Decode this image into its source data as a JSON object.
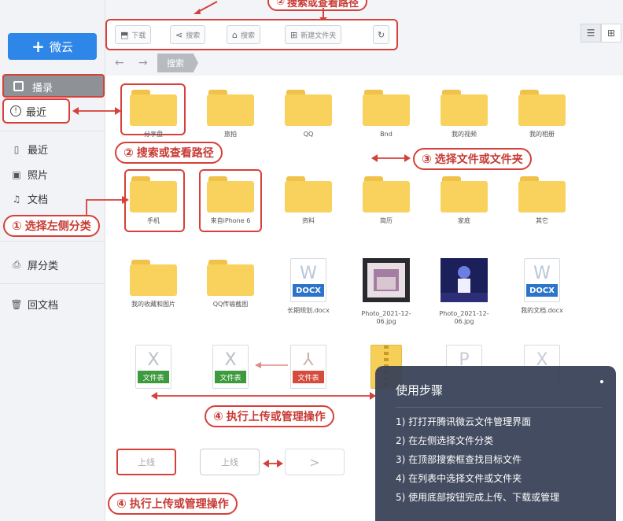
{
  "sidebar": {
    "new_button": {
      "icon": "plus-icon",
      "label": "微云"
    },
    "selected_item": {
      "label": "播录"
    },
    "recent_highlight": {
      "label": "最近"
    },
    "items": [
      {
        "label": "最近",
        "icon": "clock-icon"
      },
      {
        "label": "照片",
        "icon": "image-icon"
      },
      {
        "label": "文档",
        "icon": "music-icon"
      },
      {
        "label": "屏分类",
        "icon": "category-icon"
      },
      {
        "label": "回文档",
        "icon": "trash-icon"
      }
    ]
  },
  "toolbar": {
    "buttons": [
      {
        "label": "下载",
        "icon": "upload-icon"
      },
      {
        "label": "搜索",
        "icon": "share-icon"
      },
      {
        "label": "搜索",
        "icon": "home-icon"
      },
      {
        "label": "新建文件夹",
        "icon": "new-folder-icon"
      },
      {
        "label": "",
        "icon": "refresh-icon"
      }
    ]
  },
  "breadcrumb": {
    "back": "←",
    "forward": "→",
    "current": "搜索"
  },
  "files": {
    "row1": [
      "分享盘",
      "旅拍",
      "QQ",
      "Bnd",
      "我的视频",
      "我的相册"
    ],
    "row2": [
      "手机",
      "来自iPhone 6",
      "资料",
      "简历",
      "家庭",
      "其它"
    ],
    "row3": [
      {
        "type": "folder",
        "label": "我的收藏和图片"
      },
      {
        "type": "folder",
        "label": "QQ传输截图"
      },
      {
        "type": "docx",
        "badge": "DOCX",
        "letter": "W",
        "label": "长期规划.docx"
      },
      {
        "type": "photo",
        "label": "Photo_2021-12-06.jpg"
      },
      {
        "type": "photo",
        "label": "Photo_2021-12-06.jpg"
      },
      {
        "type": "docx",
        "badge": "DOCX",
        "letter": "W",
        "label": "我的文档.docx"
      }
    ],
    "row4": [
      {
        "type": "xlsx",
        "letter": "X",
        "badge": "文件表"
      },
      {
        "type": "xlsx",
        "letter": "X",
        "badge": "文件表"
      },
      {
        "type": "pdf",
        "letter": "",
        "badge": "文件表"
      },
      {
        "type": "zip",
        "letter": "",
        "badge": ""
      },
      {
        "type": "ppt",
        "letter": "P",
        "badge": ""
      },
      {
        "type": "xlsx",
        "letter": "X",
        "badge": ""
      }
    ]
  },
  "callouts": {
    "top": {
      "num": "②",
      "text": "搜索或查看路径"
    },
    "c1": {
      "num": "①",
      "text": "选择左侧分类"
    },
    "c2": {
      "num": "②",
      "text": "搜索或查看路径"
    },
    "c3": {
      "num": "③",
      "text": "选择文件或文件夹"
    },
    "c4a": {
      "num": "④",
      "text": "执行上传或管理操作"
    },
    "c4b": {
      "num": "④",
      "text": "执行上传或管理操作"
    }
  },
  "bottom_buttons": [
    {
      "label": "上线"
    },
    {
      "label": "上线"
    },
    {
      "label": ""
    }
  ],
  "guide": {
    "title": "使用步骤",
    "steps": [
      "1) 打打开腾讯微云文件管理界面",
      "2) 在左侧选择文件分类",
      "3) 在顶部搜索框查找目标文件",
      "4) 在列表中选择文件或文件夹",
      "5) 使用底部按钮完成上传、下载或管理"
    ]
  },
  "colors": {
    "accent": "#2e86e8",
    "annotation": "#d6403a",
    "folder": "#f8d25d"
  }
}
